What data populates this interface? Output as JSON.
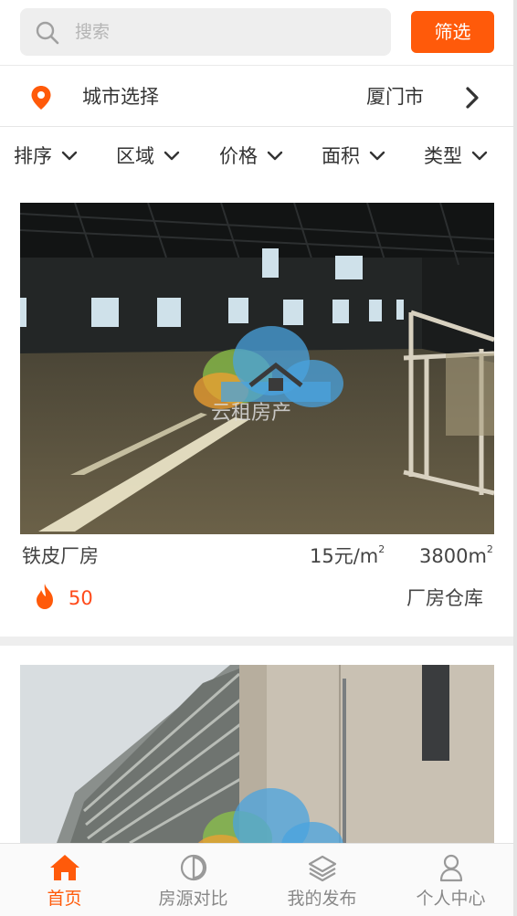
{
  "search": {
    "placeholder": "搜索",
    "filter_label": "筛选"
  },
  "city": {
    "label": "城市选择",
    "value": "厦门市"
  },
  "sort_bar": [
    "排序",
    "区域",
    "价格",
    "面积",
    "类型"
  ],
  "watermark_text": "云租房产",
  "listings": [
    {
      "title": "铁皮厂房",
      "price": "15元/m",
      "price_unit_sup": "2",
      "area": "3800m",
      "area_unit_sup": "2",
      "heat": "50",
      "type": "厂房仓库"
    },
    {
      "title": "",
      "price": "",
      "area": "",
      "heat": "",
      "type": ""
    }
  ],
  "tabbar": [
    {
      "label": "首页",
      "icon": "home-icon",
      "active": true
    },
    {
      "label": "房源对比",
      "icon": "compare-icon",
      "active": false
    },
    {
      "label": "我的发布",
      "icon": "layers-icon",
      "active": false
    },
    {
      "label": "个人中心",
      "icon": "user-icon",
      "active": false
    }
  ],
  "colors": {
    "accent": "#ff5a0a",
    "heat": "#ff4a1a",
    "tab_inactive": "#888888"
  }
}
